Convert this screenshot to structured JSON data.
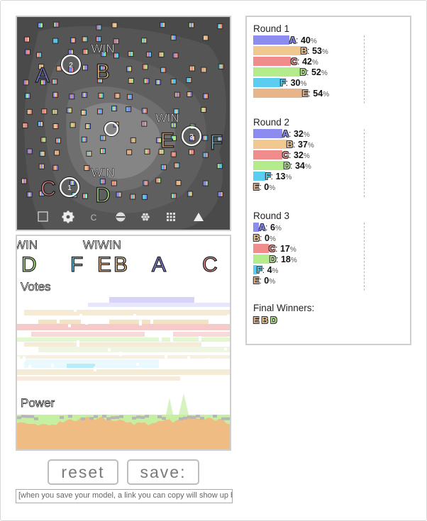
{
  "colors": {
    "A": "#8c8cf0",
    "B": "#f0c890",
    "C": "#f08c8c",
    "D": "#b4ec8c",
    "E": "#e8b48a",
    "F": "#5acdf0"
  },
  "sim": {
    "win_label": "WIN",
    "candidates": [
      {
        "id": "A",
        "label": "A",
        "color": "#8c8cf0"
      },
      {
        "id": "B",
        "label": "B",
        "color": "#f0c890"
      },
      {
        "id": "C",
        "label": "C",
        "color": "#f08c8c"
      },
      {
        "id": "D",
        "label": "D",
        "color": "#b4ec8c"
      },
      {
        "id": "E",
        "label": "E",
        "color": "#e8b48a"
      },
      {
        "id": "F",
        "label": "F",
        "color": "#5acdf0"
      }
    ],
    "voter_groups": [
      {
        "id": "2",
        "label": "2"
      },
      {
        "id": "1",
        "label": "1"
      },
      {
        "id": "3",
        "label": "3"
      },
      {
        "id": "center",
        "label": ""
      }
    ],
    "toolbar_icons": [
      "square-icon",
      "gear-icon",
      "c-icon",
      "smiley-icon",
      "flower-icon",
      "grid-icon",
      "triangle-icon"
    ],
    "toolbar_text": {
      "c": "C"
    }
  },
  "votes_panel": {
    "header_candidates": [
      {
        "label": "D",
        "color": "#b4ec8c"
      },
      {
        "label": "F",
        "color": "#5acdf0"
      },
      {
        "label": "E",
        "color": "#e8b48a"
      },
      {
        "label": "B",
        "color": "#f0c890"
      },
      {
        "label": "A",
        "color": "#8c8cf0"
      },
      {
        "label": "C",
        "color": "#f08c8c"
      }
    ],
    "win_label_left": "WIN",
    "win_label_mid": "WIWIN",
    "votes_label": "Votes",
    "power_label": "Power"
  },
  "controls": {
    "reset_label": "reset",
    "save_label": "save:",
    "link_text": "[when you save your model, a link you can copy will show up here]"
  },
  "results": {
    "rounds": [
      {
        "title": "Round 1",
        "rows": [
          {
            "id": "A",
            "pct": 40
          },
          {
            "id": "B",
            "pct": 53
          },
          {
            "id": "C",
            "pct": 42
          },
          {
            "id": "D",
            "pct": 52
          },
          {
            "id": "F",
            "pct": 30
          },
          {
            "id": "E",
            "pct": 54
          }
        ]
      },
      {
        "title": "Round 2",
        "rows": [
          {
            "id": "A",
            "pct": 32
          },
          {
            "id": "B",
            "pct": 37
          },
          {
            "id": "C",
            "pct": 32
          },
          {
            "id": "D",
            "pct": 34
          },
          {
            "id": "F",
            "pct": 13
          },
          {
            "id": "E",
            "pct": 0
          }
        ]
      },
      {
        "title": "Round 3",
        "rows": [
          {
            "id": "A",
            "pct": 6
          },
          {
            "id": "B",
            "pct": 0
          },
          {
            "id": "C",
            "pct": 17
          },
          {
            "id": "D",
            "pct": 18
          },
          {
            "id": "F",
            "pct": 4
          },
          {
            "id": "E",
            "pct": 0
          }
        ]
      }
    ],
    "final_title": "Final Winners:",
    "final_winners": [
      "E",
      "B",
      "D"
    ]
  }
}
